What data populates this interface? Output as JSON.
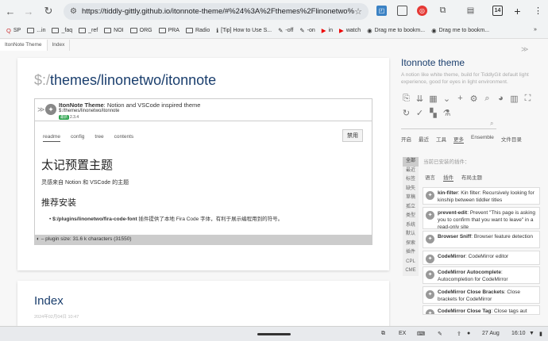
{
  "browser": {
    "url": "https://tiddly-gittly.github.io/itonnote-theme/#%24%3A%2Fthemes%2Flinonetwo%2Fitonnote:%...",
    "tab_count": "14",
    "bookmarks": [
      "SP",
      "...in",
      "_faq",
      "_ref",
      "NOI",
      "ORG",
      "PRA",
      "Radio",
      "[Tip] How to Use S...",
      "-off",
      "-on",
      "in",
      "watch",
      "Drag me to bookm...",
      "Drag me to bookm..."
    ],
    "more": "»"
  },
  "tabs": [
    "ItonNote Theme",
    "Index"
  ],
  "tiddler1": {
    "title_prefix": "$:/",
    "title_rest": "themes/linonetwo/itonnote",
    "plugin": {
      "name": "ItonNote Theme",
      "description": ": Notion and VSCode inspired theme",
      "path": "$:/themes/linonetwo/itonnote",
      "badge": "最新",
      "version": "2.3.4",
      "tabs": [
        "readme",
        "config",
        "tree",
        "contents"
      ],
      "disable_label": "禁用",
      "h1": "太记预置主题",
      "p1": "灵感来自 Notion 和 VSCode 的主题",
      "h2": "推荐安装",
      "li_bold": "$:/plugins/linonetwo/fira-code-font",
      "li_text": " 插件提供了本地 Fira Code 字体，有利于展示编程用到的符号。",
      "size": "– plugin size: 31.6 k characters (31550)"
    }
  },
  "tiddler2": {
    "title": "Index",
    "date": "2024年02月04日 10:47"
  },
  "sidebar": {
    "title": "Itonnote theme",
    "subtitle": "A notion like white theme, build for TiddlyGit default light experience, good for eyes in light environment.",
    "tabs": [
      "开启",
      "最近",
      "工具",
      "更多",
      "Ensemble",
      "文件目录"
    ],
    "vtabs": [
      "全部",
      "最近",
      "标签",
      "缺失",
      "草稿",
      "孤立",
      "类型",
      "系统",
      "默认",
      "探索",
      "插件",
      "CPL",
      "CME"
    ],
    "installed_label": "当前已安装的插件：",
    "subtabs": [
      "语言",
      "插件",
      "布局主题"
    ],
    "plugins": [
      {
        "name": "kin-filter",
        "desc": ": Kin filter: Recursively looking for kinship between tiddler titles"
      },
      {
        "name": "prevent-edit",
        "desc": ": Prevent \"This page is asking you to confirm that you want to leave\" in a read-only site"
      },
      {
        "name": "Browser Sniff",
        "desc": ": Browser feature detection"
      },
      {
        "name": "CodeMirror",
        "desc": ": CodeMirror editor"
      },
      {
        "name": "CodeMirror Autocomplete",
        "desc": ": Autocompletion for CodeMirror"
      },
      {
        "name": "CodeMirror Close Brackets",
        "desc": ": Close brackets for CodeMirror"
      },
      {
        "name": "CodeMirror Close Tag",
        "desc": ": Close tags aut"
      }
    ]
  },
  "statusbar": {
    "ex": "EX",
    "date": "27 Aug",
    "time": "16:10"
  }
}
